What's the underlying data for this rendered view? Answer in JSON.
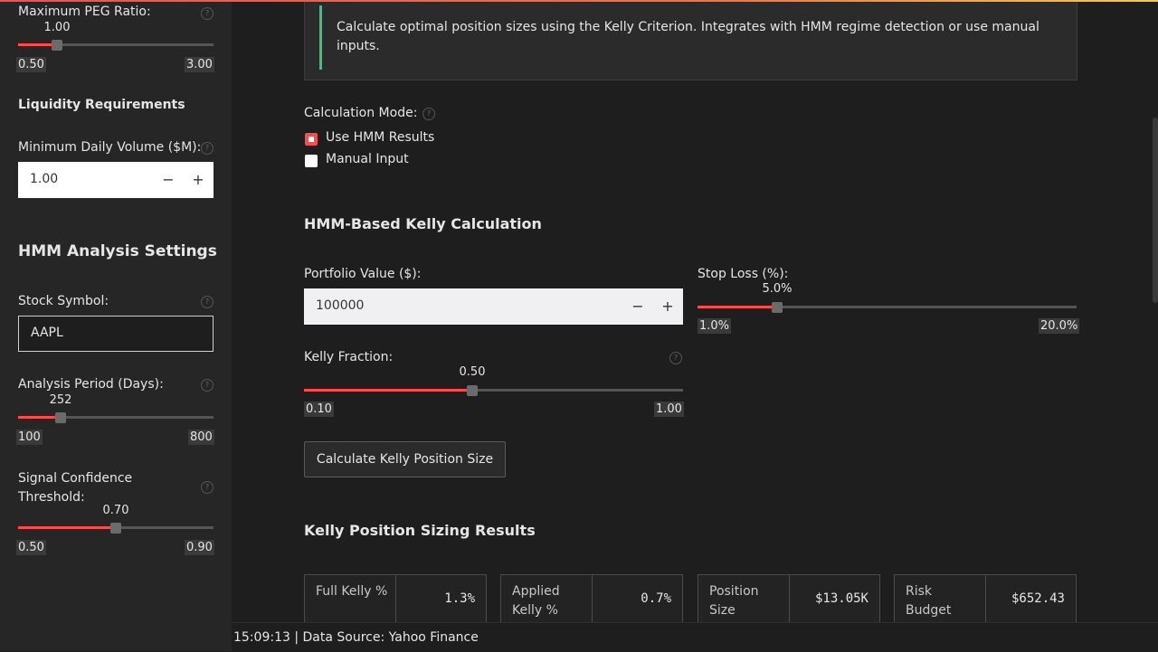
{
  "sidebar": {
    "peg": {
      "label": "Maximum PEG Ratio:",
      "value": "1.00",
      "min": "0.50",
      "max": "3.00",
      "fraction": 0.2
    },
    "liquidity_heading": "Liquidity Requirements",
    "volume": {
      "label": "Minimum Daily Volume ($M):",
      "value": "1.00",
      "minus": "−",
      "plus": "+"
    },
    "hmm_heading": "HMM Analysis Settings",
    "symbol": {
      "label": "Stock Symbol:",
      "value": "AAPL"
    },
    "period": {
      "label": "Analysis Period (Days):",
      "value": "252",
      "min": "100",
      "max": "800",
      "fraction": 0.217
    },
    "confidence": {
      "label": "Signal Confidence Threshold:",
      "value": "0.70",
      "min": "0.50",
      "max": "0.90",
      "fraction": 0.5
    }
  },
  "main": {
    "info_text": "Calculate optimal position sizes using the Kelly Criterion. Integrates with HMM regime detection or use manual inputs.",
    "mode": {
      "label": "Calculation Mode:",
      "options": [
        {
          "label": "Use HMM Results",
          "selected": true
        },
        {
          "label": "Manual Input",
          "selected": false
        }
      ]
    },
    "hmm_section_title": "HMM-Based Kelly Calculation",
    "portfolio": {
      "label": "Portfolio Value ($):",
      "value": "100000",
      "minus": "−",
      "plus": "+"
    },
    "stop_loss": {
      "label": "Stop Loss (%):",
      "value": "5.0%",
      "min": "1.0%",
      "max": "20.0%",
      "fraction": 0.21
    },
    "kelly_fraction": {
      "label": "Kelly Fraction:",
      "value": "0.50",
      "min": "0.10",
      "max": "1.00",
      "fraction": 0.444
    },
    "calc_button": "Calculate Kelly Position Size",
    "results_title": "Kelly Position Sizing Results",
    "metrics": [
      {
        "label": "Full Kelly %",
        "value": "1.3%"
      },
      {
        "label": "Applied Kelly %",
        "value": "0.7%"
      },
      {
        "label": "Position Size",
        "value": "$13.05K"
      },
      {
        "label": "Risk Budget",
        "value": "$652.43"
      }
    ]
  },
  "footer": {
    "text": "15:09:13 | Data Source: Yahoo Finance"
  },
  "colors": {
    "accent": "#ff4b4b",
    "info_bar": "#2ecc71",
    "background": "#1e1e1e",
    "sidebar": "#262626"
  }
}
